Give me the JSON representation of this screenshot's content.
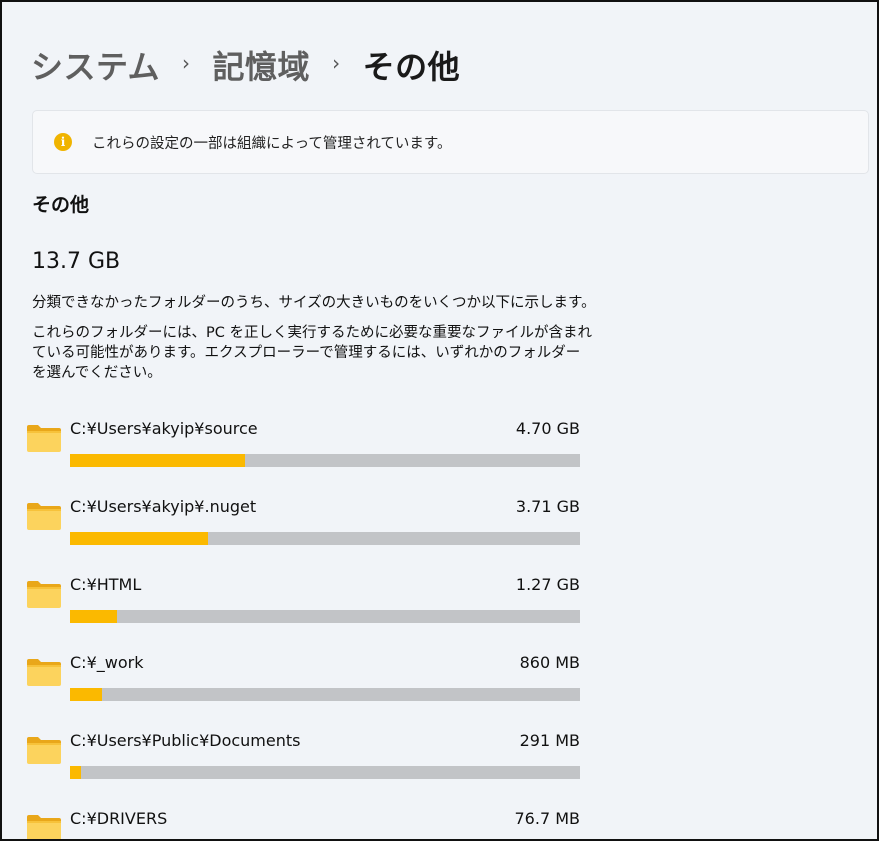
{
  "breadcrumb": {
    "items": [
      "システム",
      "記憶域"
    ],
    "current": "その他",
    "separator": "›"
  },
  "notice": {
    "icon": "info-icon",
    "icon_glyph": "i",
    "text": "これらの設定の一部は組織によって管理されています。"
  },
  "section": {
    "title": "その他",
    "total": "13.7 GB",
    "description_1": "分類できなかったフォルダーのうち、サイズの大きいものをいくつか以下に示します。",
    "description_2": "これらのフォルダーには、PC を正しく実行するために必要な重要なファイルが含まれている可能性があります。エクスプローラーで管理するには、いずれかのフォルダーを選んでください。"
  },
  "colors": {
    "accent": "#fbb900",
    "bar_track": "#c2c4c7",
    "background": "#f1f4f8"
  },
  "folders": [
    {
      "path": "C:¥Users¥akyip¥source",
      "size": "4.70 GB",
      "fill_fraction": 0.344
    },
    {
      "path": "C:¥Users¥akyip¥.nuget",
      "size": "3.71 GB",
      "fill_fraction": 0.271
    },
    {
      "path": "C:¥HTML",
      "size": "1.27 GB",
      "fill_fraction": 0.093
    },
    {
      "path": "C:¥_work",
      "size": "860 MB",
      "fill_fraction": 0.062
    },
    {
      "path": "C:¥Users¥Public¥Documents",
      "size": "291 MB",
      "fill_fraction": 0.021
    },
    {
      "path": "C:¥DRIVERS",
      "size": "76.7 MB",
      "fill_fraction": 0.006
    }
  ]
}
